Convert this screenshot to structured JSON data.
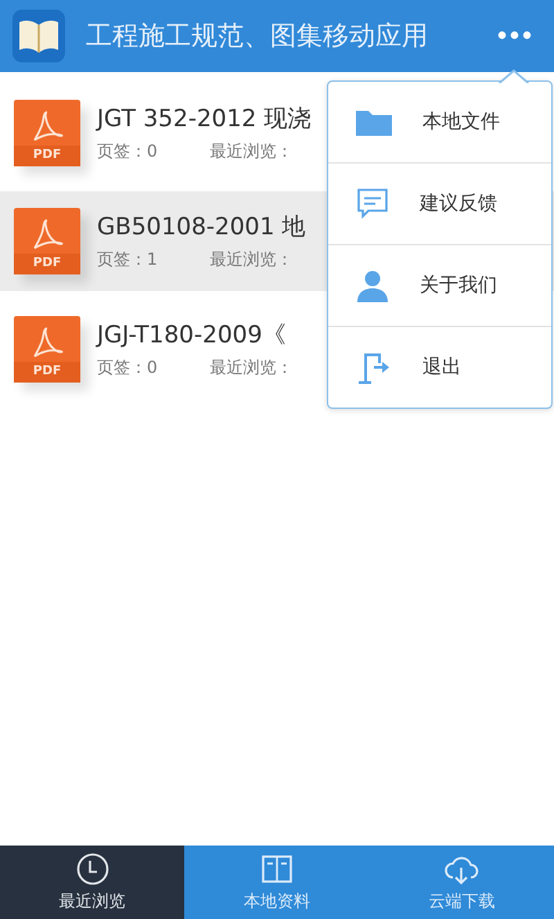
{
  "header": {
    "title": "工程施工规范、图集移动应用",
    "menu_glyph": "•••"
  },
  "files": [
    {
      "title": "JGT 352-2012 现浇",
      "badge": "PDF",
      "bookmarks": "页签：0",
      "recent": "最近浏览：",
      "selected": false
    },
    {
      "title": "GB50108-2001 地",
      "badge": "PDF",
      "bookmarks": "页签：1",
      "recent": "最近浏览：",
      "selected": true
    },
    {
      "title": "JGJ-T180-2009《",
      "badge": "PDF",
      "bookmarks": "页签：0",
      "recent": "最近浏览：",
      "selected": false
    }
  ],
  "menu": [
    {
      "kind": "folder",
      "label": "本地文件"
    },
    {
      "kind": "feedback",
      "label": "建议反馈"
    },
    {
      "kind": "user",
      "label": "关于我们"
    },
    {
      "kind": "exit",
      "label": "退出"
    }
  ],
  "tabs": [
    {
      "kind": "clock",
      "label": "最近浏览",
      "selected": true
    },
    {
      "kind": "book",
      "label": "本地资料",
      "selected": false
    },
    {
      "kind": "cloud",
      "label": "云端下载",
      "selected": false
    }
  ]
}
